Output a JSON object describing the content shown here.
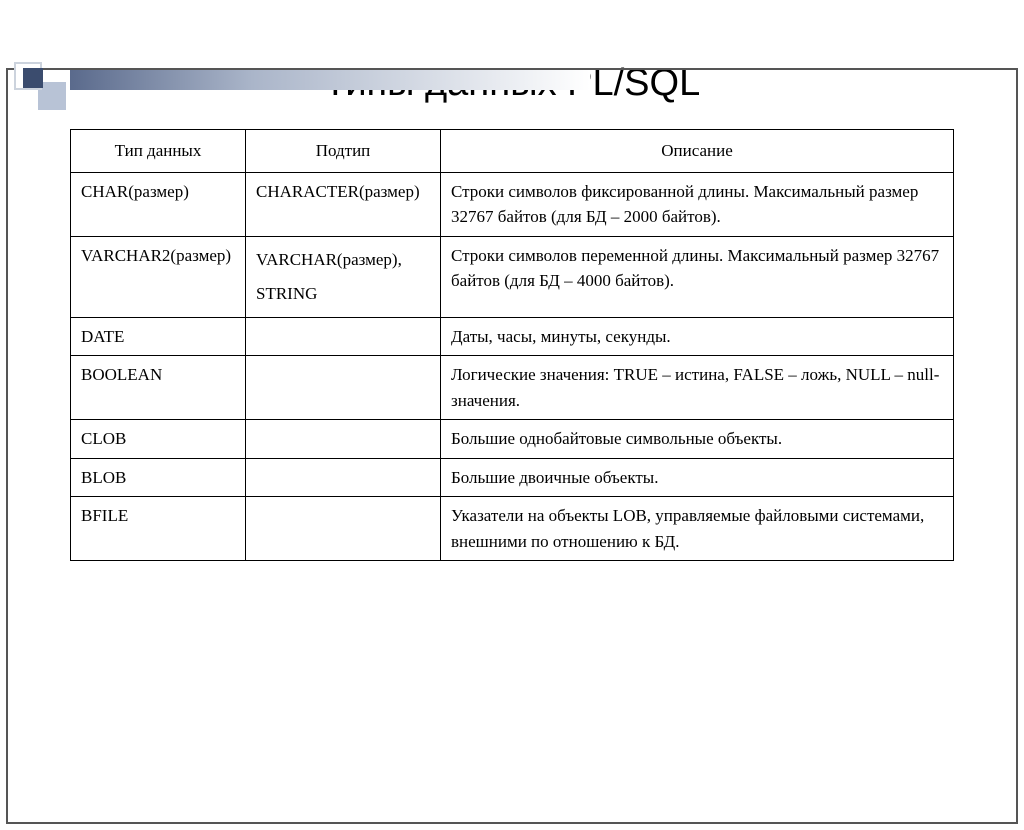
{
  "slide": {
    "title": "Типы данных PL/SQL"
  },
  "table": {
    "headers": {
      "type": "Тип данных",
      "subtype": "Подтип",
      "desc": "Описание"
    },
    "rows": [
      {
        "type": "CHAR(размер)",
        "subtype": "CHARACTER(размер)",
        "desc": "Строки символов фиксированной длины. Максимальный размер 32767 байтов (для БД – 2000 байтов)."
      },
      {
        "type": "VARCHAR2(размер)",
        "subtype": "VARCHAR(размер),\nSTRING",
        "desc": "Строки символов переменной длины. Максимальный размер 32767 байтов (для БД – 4000 байтов)."
      },
      {
        "type": "DATE",
        "subtype": "",
        "desc": "Даты, часы, минуты, секунды."
      },
      {
        "type": "BOOLEAN",
        "subtype": "",
        "desc": "Логические значения: TRUE – истина, FALSE – ложь, NULL – null-значения."
      },
      {
        "type": "CLOB",
        "subtype": "",
        "desc": "Большие однобайтовые символьные объекты."
      },
      {
        "type": "BLOB",
        "subtype": "",
        "desc": "Большие двоичные объекты."
      },
      {
        "type": "BFILE",
        "subtype": "",
        "desc": "Указатели на объекты LOB, управляемые файловыми системами, внешними по отношению к БД."
      }
    ]
  }
}
